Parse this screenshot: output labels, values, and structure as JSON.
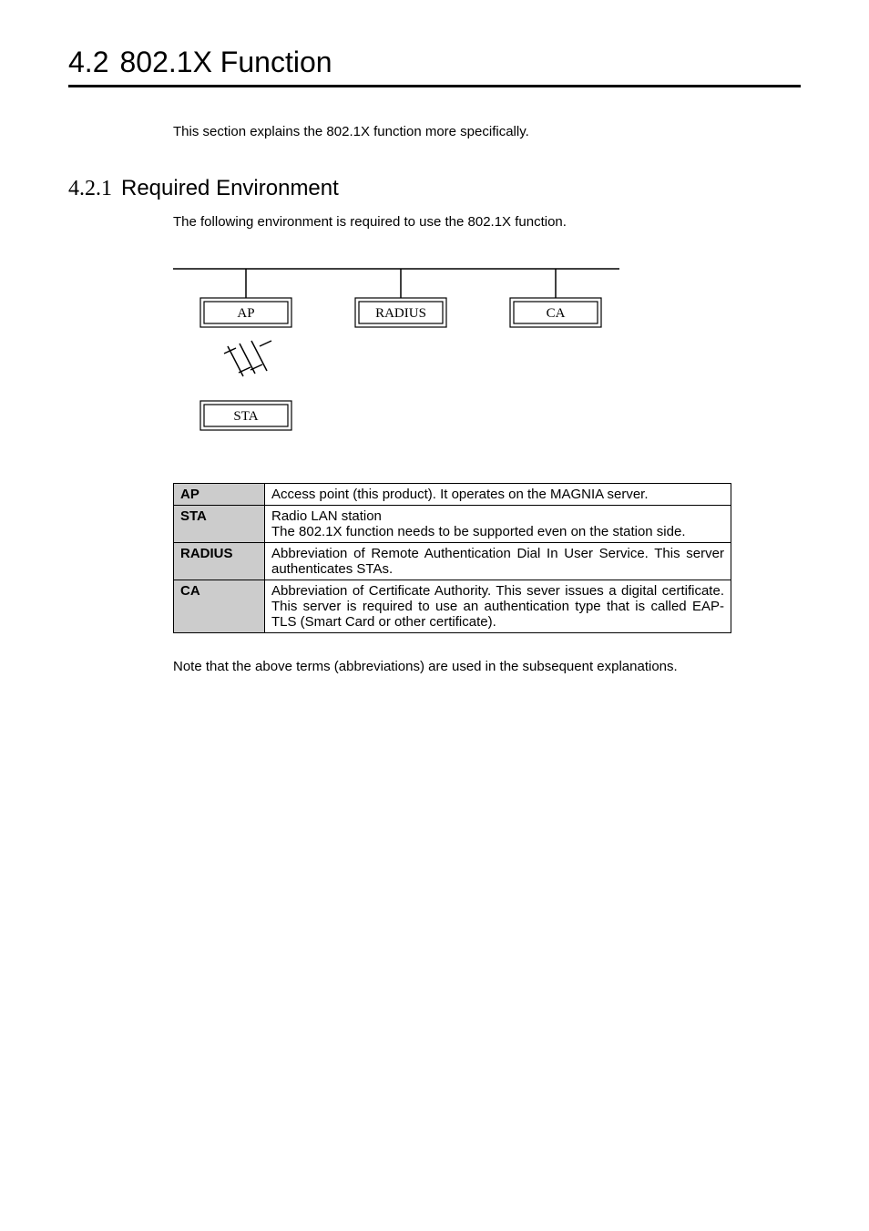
{
  "section": {
    "number": "4.2",
    "title": "802.1X Function",
    "intro": "This section explains the 802.1X function more specifically."
  },
  "subsection": {
    "number": "4.2.1",
    "title": "Required Environment",
    "intro": "The following environment is required to use the 802.1X function."
  },
  "diagram": {
    "labels": {
      "ap": "AP",
      "radius": "RADIUS",
      "ca": "CA",
      "sta": "STA"
    }
  },
  "table": {
    "rows": [
      {
        "term": "AP",
        "desc": "Access point (this product).   It operates on the MAGNIA server."
      },
      {
        "term": "STA",
        "desc": "Radio LAN station\nThe 802.1X function needs to be supported even on the station side."
      },
      {
        "term": "RADIUS",
        "desc": "Abbreviation of Remote Authentication Dial In User Service.  This server authenticates STAs."
      },
      {
        "term": "CA",
        "desc": "Abbreviation of Certificate Authority.   This sever issues a digital certificate.   This server is required to use an authentication type that is called EAP-TLS (Smart Card or other certificate)."
      }
    ]
  },
  "note": "Note that the above terms (abbreviations) are used in the subsequent explanations."
}
